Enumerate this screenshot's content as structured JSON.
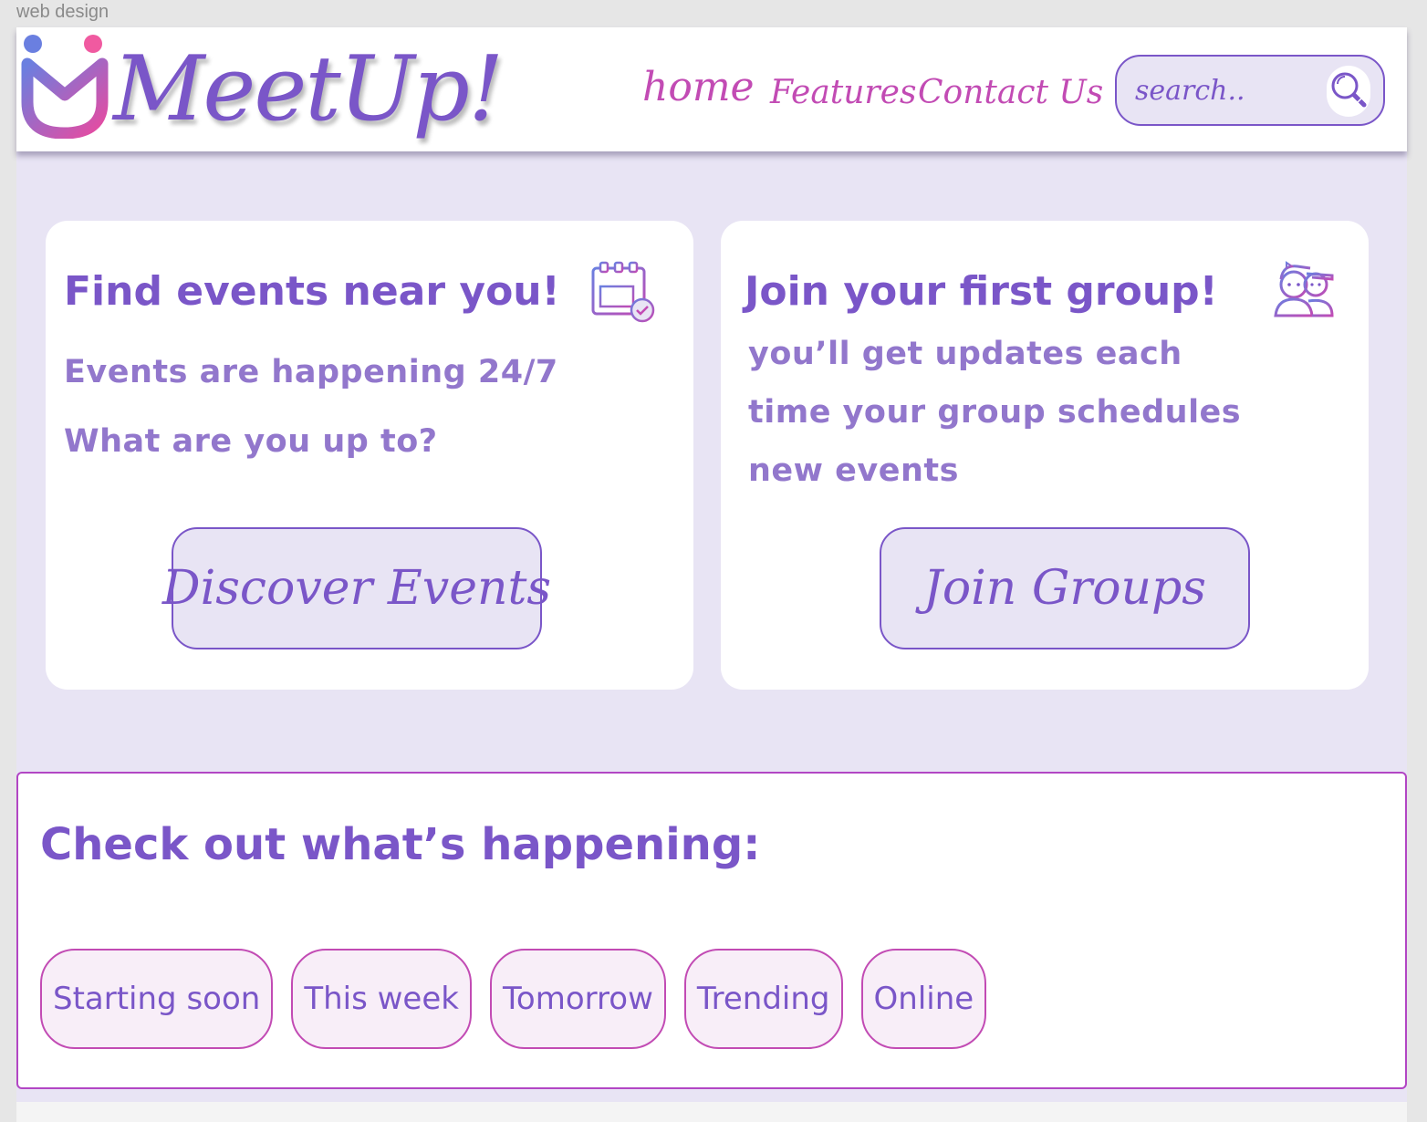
{
  "frame": {
    "label": "web design"
  },
  "header": {
    "brand": "MeetUp!",
    "nav": [
      {
        "label": "home"
      },
      {
        "label": "Features"
      },
      {
        "label": "Contact Us"
      }
    ],
    "search": {
      "placeholder": "search.."
    }
  },
  "cards": [
    {
      "title": "Find events near you!",
      "lines": [
        "Events are happening 24/7",
        "What are you up to?"
      ],
      "button": "Discover Events",
      "icon": "calendar-check-icon"
    },
    {
      "title": "Join your first group!",
      "lines": [
        "you’ll get updates each",
        "time your group schedules",
        "new events"
      ],
      "button": "Join Groups",
      "icon": "group-people-icon"
    }
  ],
  "happening": {
    "title": "Check out what’s happening:",
    "filters": [
      "Starting soon",
      "This week",
      "Tomorrow",
      "Trending",
      "Online"
    ]
  },
  "colors": {
    "page_bg": "#e8e4f4",
    "primary": "#7a56c8",
    "text_secondary": "#9277cc",
    "accent_pink": "#c24bb4",
    "chip_bg": "#f8eef8",
    "card_bg": "#ffffff"
  }
}
